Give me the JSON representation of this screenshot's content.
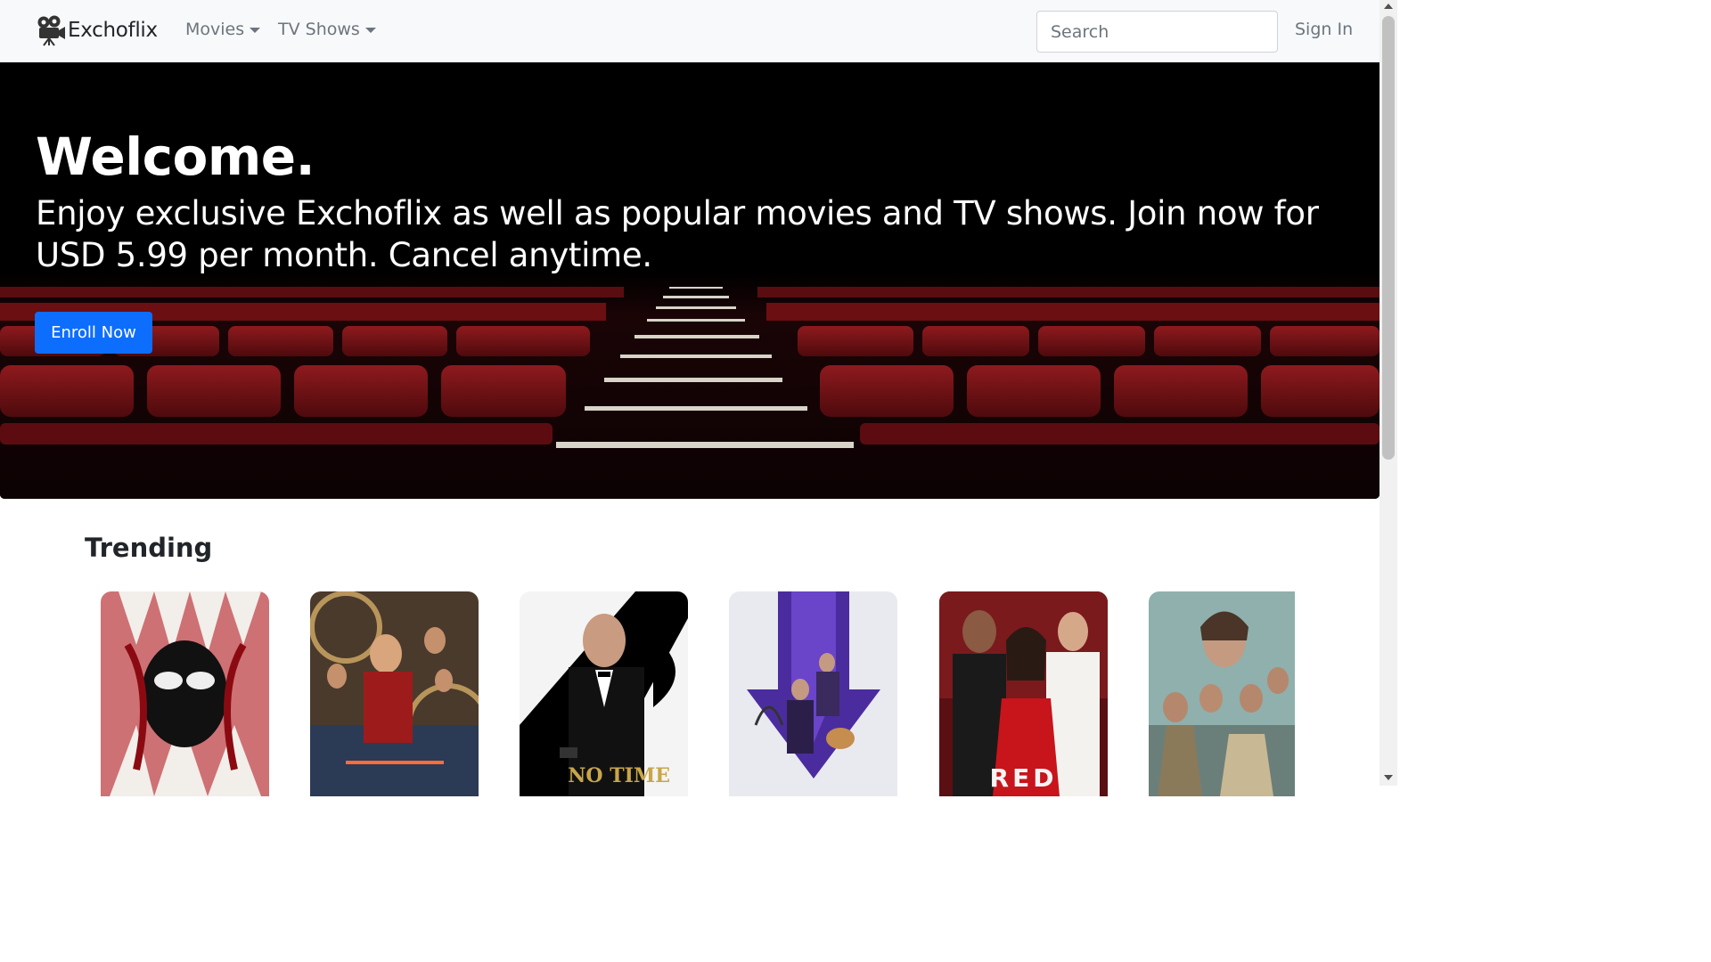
{
  "brand": {
    "name": "Exchoflix",
    "logo_icon": "film-camera-icon"
  },
  "nav": {
    "items": [
      {
        "label": "Movies",
        "has_dropdown": true
      },
      {
        "label": "TV Shows",
        "has_dropdown": true
      }
    ],
    "search_placeholder": "Search",
    "signin_label": "Sign In"
  },
  "hero": {
    "title": "Welcome.",
    "subtitle": "Enjoy exclusive Exchoflix as well as popular movies and TV shows. Join now for USD 5.99 per month. Cancel anytime.",
    "button_label": "Enroll Now",
    "background": "cinema-seats-image"
  },
  "trending": {
    "title": "Trending",
    "posters": [
      {
        "image": "venom-poster",
        "caption": ""
      },
      {
        "image": "shang-chi-poster",
        "caption": ""
      },
      {
        "image": "no-time-to-die-poster",
        "caption": "NO TIME"
      },
      {
        "image": "hawkeye-poster",
        "caption": ""
      },
      {
        "image": "red-notice-poster",
        "caption": "RED"
      },
      {
        "image": "dune-poster",
        "caption": ""
      }
    ]
  },
  "colors": {
    "navbar_bg": "#f8f9fa",
    "primary": "#0d6efd",
    "hero_bg": "#000000",
    "seat_red": "#7a1015"
  }
}
